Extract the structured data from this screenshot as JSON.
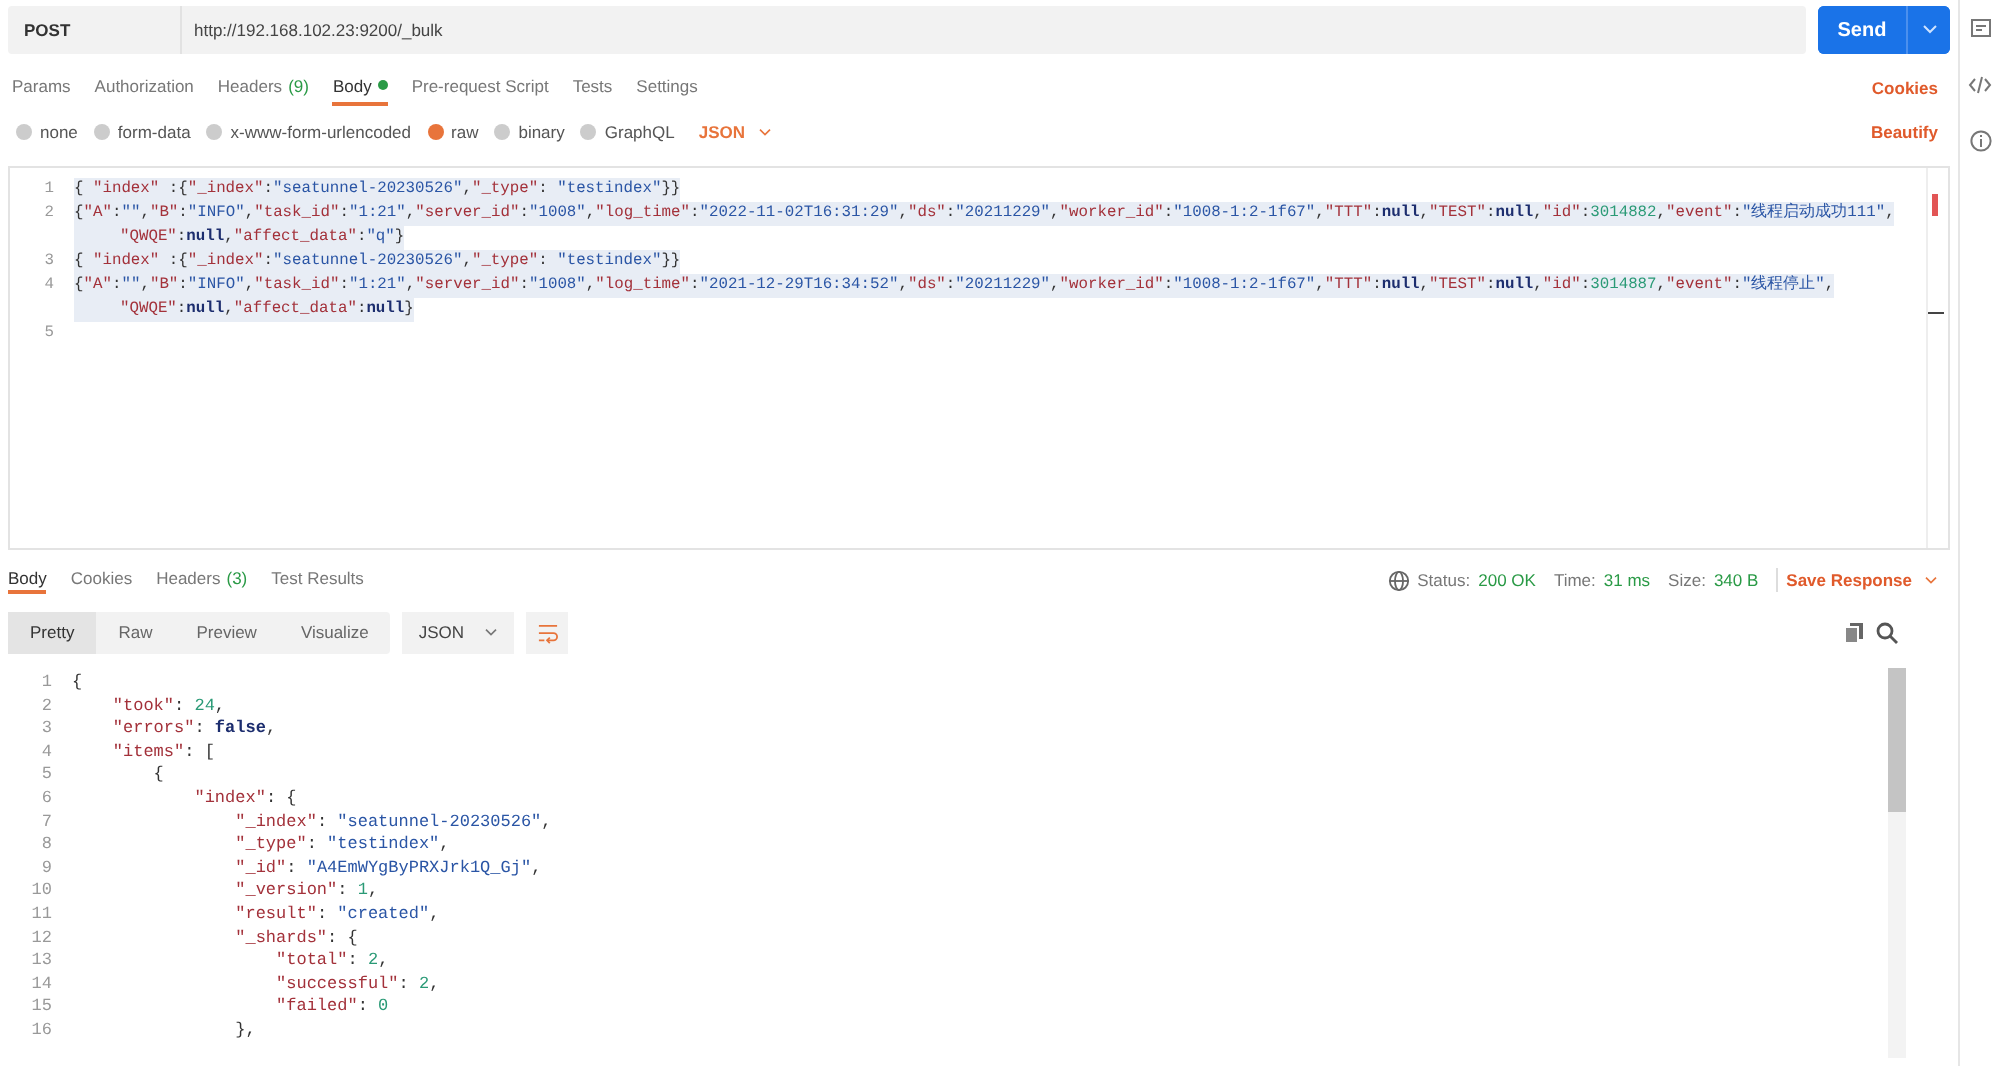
{
  "request": {
    "method": "POST",
    "url": "http://192.168.102.23:9200/_bulk",
    "send": "Send"
  },
  "request_tabs": [
    {
      "label": "Params",
      "selected": false
    },
    {
      "label": "Authorization",
      "selected": false
    },
    {
      "label": "Headers",
      "count": "(9)",
      "selected": false
    },
    {
      "label": "Body",
      "selected": true,
      "dot": true
    },
    {
      "label": "Pre-request Script",
      "selected": false
    },
    {
      "label": "Tests",
      "selected": false
    },
    {
      "label": "Settings",
      "selected": false
    }
  ],
  "cookies_link": "Cookies",
  "body_types": [
    {
      "label": "none",
      "selected": false
    },
    {
      "label": "form-data",
      "selected": false
    },
    {
      "label": "x-www-form-urlencoded",
      "selected": false
    },
    {
      "label": "raw",
      "selected": true
    },
    {
      "label": "binary",
      "selected": false
    },
    {
      "label": "GraphQL",
      "selected": false
    }
  ],
  "format": "JSON",
  "beautify": "Beautify",
  "request_body": [
    {
      "number": "1",
      "text": "{ \"index\" :{\"_index\":\"seatunnel-20230526\",\"_type\": \"testindex\"}}"
    },
    {
      "number": "2",
      "text": "{\"A\":\"\",\"B\":\"INFO\",\"task_id\":\"1:21\",\"server_id\":\"1008\",\"log_time\":\"2022-11-02T16:31:29\",\"ds\":\"20211229\",\"worker_id\":\"1008-1:2-1f67\",\"TTT\":null,\"TEST\":null,\"id\":3014882,\"event\":\"线程启动成功111\",",
      "wrap": "\"QWQE\":null,\"affect_data\":\"q\"}"
    },
    {
      "number": "3",
      "text": "{ \"index\" :{\"_index\":\"seatunnel-20230526\",\"_type\": \"testindex\"}}"
    },
    {
      "number": "4",
      "text": "{\"A\":\"\",\"B\":\"INFO\",\"task_id\":\"1:21\",\"server_id\":\"1008\",\"log_time\":\"2021-12-29T16:34:52\",\"ds\":\"20211229\",\"worker_id\":\"1008-1:2-1f67\",\"TTT\":null,\"TEST\":null,\"id\":3014887,\"event\":\"线程停止\",",
      "wrap": "\"QWQE\":null,\"affect_data\":null}"
    },
    {
      "number": "5"
    }
  ],
  "response_tabs": [
    {
      "label": "Body",
      "selected": true
    },
    {
      "label": "Cookies",
      "selected": false
    },
    {
      "label": "Headers",
      "count": "(3)",
      "selected": false
    },
    {
      "label": "Test Results",
      "selected": false
    }
  ],
  "response_status": {
    "status_label": "Status:",
    "status": "200 OK",
    "time_label": "Time:",
    "time": "31 ms",
    "size_label": "Size:",
    "size": "340 B",
    "save": "Save Response"
  },
  "view_modes": [
    {
      "label": "Pretty",
      "selected": true
    },
    {
      "label": "Raw",
      "selected": false
    },
    {
      "label": "Preview",
      "selected": false
    },
    {
      "label": "Visualize",
      "selected": false
    }
  ],
  "response_format": "JSON",
  "response_body": [
    {
      "number": "1",
      "text": "{"
    },
    {
      "number": "2",
      "text": "    \"took\": 24,"
    },
    {
      "number": "3",
      "text": "    \"errors\": false,"
    },
    {
      "number": "4",
      "text": "    \"items\": ["
    },
    {
      "number": "5",
      "text": "        {"
    },
    {
      "number": "6",
      "text": "            \"index\": {"
    },
    {
      "number": "7",
      "text": "                \"_index\": \"seatunnel-20230526\","
    },
    {
      "number": "8",
      "text": "                \"_type\": \"testindex\","
    },
    {
      "number": "9",
      "text": "                \"_id\": \"A4EmWYgByPRXJrk1Q_Gj\","
    },
    {
      "number": "10",
      "text": "                \"_version\": 1,"
    },
    {
      "number": "11",
      "text": "                \"result\": \"created\","
    },
    {
      "number": "12",
      "text": "                \"_shards\": {"
    },
    {
      "number": "13",
      "text": "                    \"total\": 2,"
    },
    {
      "number": "14",
      "text": "                    \"successful\": 2,"
    },
    {
      "number": "15",
      "text": "                    \"failed\": 0"
    },
    {
      "number": "16",
      "text": "                },"
    }
  ]
}
